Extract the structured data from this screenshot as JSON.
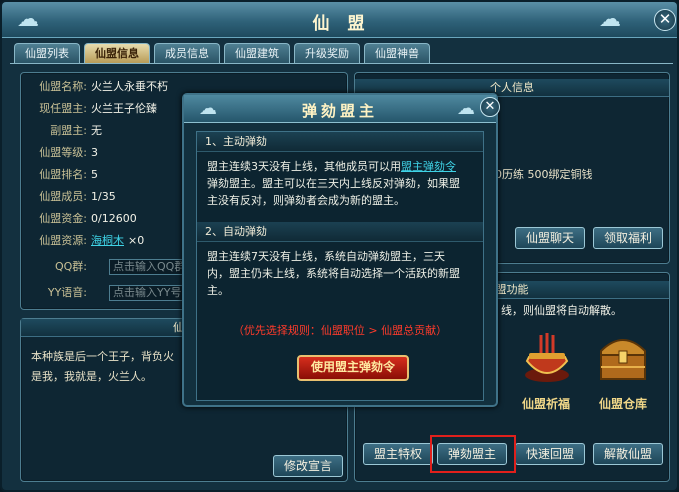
{
  "window": {
    "title": "仙 盟",
    "close": "✕"
  },
  "tabs": [
    {
      "label": "仙盟列表",
      "active": false
    },
    {
      "label": "仙盟信息",
      "active": true
    },
    {
      "label": "成员信息",
      "active": false
    },
    {
      "label": "仙盟建筑",
      "active": false
    },
    {
      "label": "升级奖励",
      "active": false
    },
    {
      "label": "仙盟神兽",
      "active": false
    }
  ],
  "info": {
    "rows": [
      {
        "label": "仙盟名称:",
        "value": "火兰人永垂不朽"
      },
      {
        "label": "现任盟主:",
        "value": "火兰王子伦臻"
      },
      {
        "label": "副盟主:",
        "value": "无"
      },
      {
        "label": "仙盟等级:",
        "value": "3"
      },
      {
        "label": "仙盟排名:",
        "value": "5"
      },
      {
        "label": "仙盟成员:",
        "value": "1/35"
      },
      {
        "label": "仙盟资金:",
        "value": "0/12600"
      }
    ],
    "resource_label": "仙盟资源:",
    "resource_link": "海桐木",
    "resource_count": "×0",
    "qq_label": "QQ群:",
    "qq_placeholder": "点击输入QQ群",
    "yy_label": "YY语音:",
    "yy_placeholder": "点击输入YY号"
  },
  "announcement": {
    "header": "仙盟",
    "text_line1": "本种族是后一个王子，背负火",
    "text_line2": "是我，我就是，火兰人。",
    "edit_button": "修改宣言"
  },
  "personal": {
    "header": "个人信息",
    "reward_text": "0历练  500绑定铜钱",
    "chat_button": "仙盟聊天",
    "benefit_button": "领取福利"
  },
  "functions": {
    "header": "盟功能",
    "notice": "线，则仙盟将自动解散。",
    "items": [
      {
        "label": "仙盟祈福"
      },
      {
        "label": "仙盟仓库"
      }
    ],
    "buttons": [
      "盟主特权",
      "弹劾盟主",
      "快速回盟",
      "解散仙盟"
    ]
  },
  "dialog": {
    "title": "弹劾盟主",
    "close": "✕",
    "sec1_title": "1、主动弹劾",
    "sec1_line1_pre": "盟主连续3天没有上线，其他成员可以用",
    "sec1_link": "盟主弹劾令",
    "sec1_line2": "弹劾盟主。盟主可以在三天内上线反对弹劾，如果盟",
    "sec1_line3": "主没有反对，则弹劾者会成为新的盟主。",
    "sec2_title": "2、自动弹劾",
    "sec2_line1": "盟主连续7天没有上线，系统自动弹劾盟主，三天",
    "sec2_line2": "内，盟主仍未上线，系统将自动选择一个活跃的新盟",
    "sec2_line3": "主。",
    "rule": "（优先选择规则：仙盟职位 > 仙盟总贡献）",
    "use_button": "使用盟主弹劾令"
  },
  "colors": {
    "accent": "#3fd3e6",
    "warning": "#ff3b2b",
    "highlight": "#e0201c"
  }
}
